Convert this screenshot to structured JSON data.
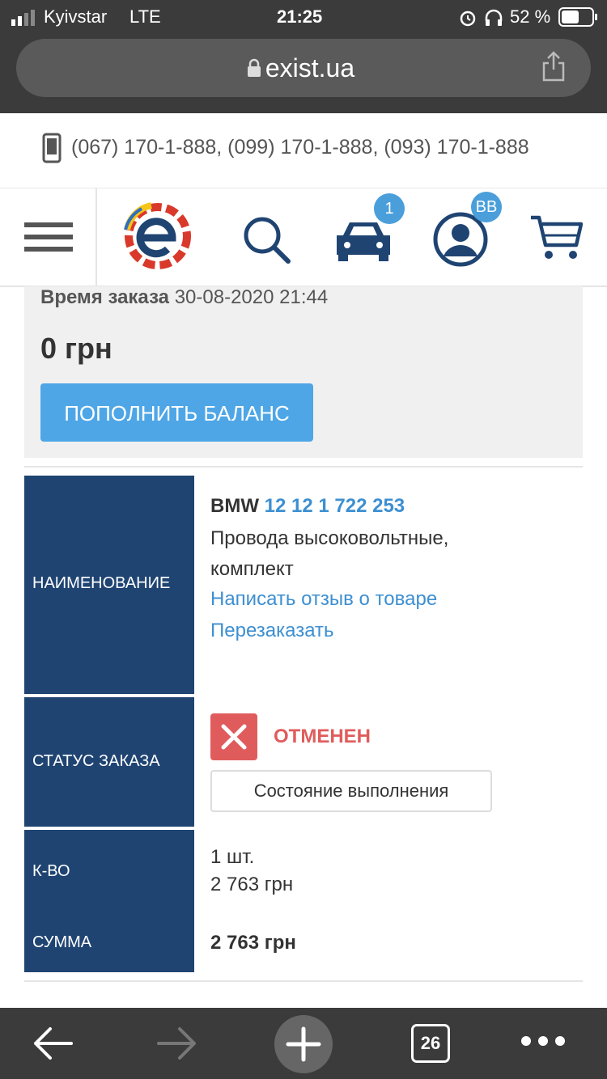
{
  "status_bar": {
    "carrier": "Kyivstar",
    "network": "LTE",
    "time": "21:25",
    "battery": "52 %"
  },
  "browser": {
    "url": "exist.ua",
    "tab_count": "26"
  },
  "phones": "(067) 170-1-888,   (099) 170-1-888,   (093) 170-1-888",
  "nav": {
    "garage_badge": "1",
    "profile_badge": "BB"
  },
  "balance": {
    "time_label": "Время заказа",
    "time_value": "30-08-2020 21:44",
    "amount": "0 грн",
    "topup_label": "ПОПОЛНИТЬ БАЛАНС"
  },
  "order": {
    "name_label": "НАИМЕНОВАНИЕ",
    "brand": "BMW",
    "part_number": "12 12 1 722 253",
    "desc_line1": "Провода высоковольтные,",
    "desc_line2": "комплект",
    "review_link": "Написать отзыв о товаре",
    "reorder_link": "Перезаказать",
    "status_label": "СТАТУС ЗАКАЗА",
    "status_value": "ОТМЕНЕН",
    "state_button": "Состояние выполнения",
    "qty_label": "К-ВО",
    "qty_value": "1 шт.",
    "price_value": "2 763 грн",
    "sum_label": "СУММА",
    "sum_value": "2 763 грн"
  },
  "colors": {
    "accent": "#4ea6e6",
    "label_bg": "#1f4472",
    "cancel": "#e05c5c",
    "link": "#3d8fd1"
  }
}
